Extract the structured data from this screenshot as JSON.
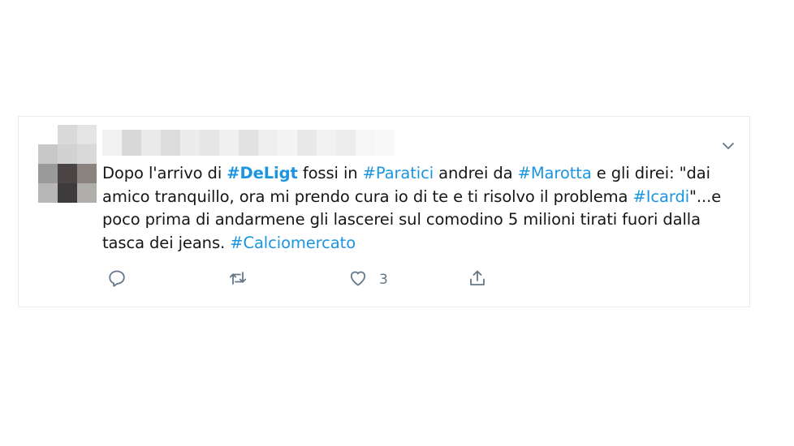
{
  "tweet": {
    "author_name": "",
    "text_parts": [
      {
        "text": "Dopo l'arrivo di ",
        "type": "text"
      },
      {
        "text": "#DeLigt",
        "type": "tag-bold"
      },
      {
        "text": " fossi in ",
        "type": "text"
      },
      {
        "text": "#Paratici",
        "type": "tag"
      },
      {
        "text": " andrei da ",
        "type": "text"
      },
      {
        "text": "#Marotta",
        "type": "tag"
      },
      {
        "text": " e gli direi: \"dai amico tranquillo, ora mi prendo cura io di te e ti risolvo il problema ",
        "type": "text"
      },
      {
        "text": "#Icardi",
        "type": "tag"
      },
      {
        "text": "\"...e poco prima di andarmene gli lascerei sul comodino 5 milioni tirati fuori dalla tasca dei jeans. ",
        "type": "text"
      },
      {
        "text": "#Calciomercato",
        "type": "tag"
      }
    ],
    "actions": {
      "reply_icon": "reply-icon",
      "retweet_icon": "retweet-icon",
      "like_icon": "heart-icon",
      "like_count": "3",
      "share_icon": "share-icon"
    },
    "menu_icon": "chevron-down-icon"
  },
  "colors": {
    "link": "#1b95e0",
    "text": "#14171a",
    "muted": "#657786",
    "border": "#e6ecf0"
  }
}
